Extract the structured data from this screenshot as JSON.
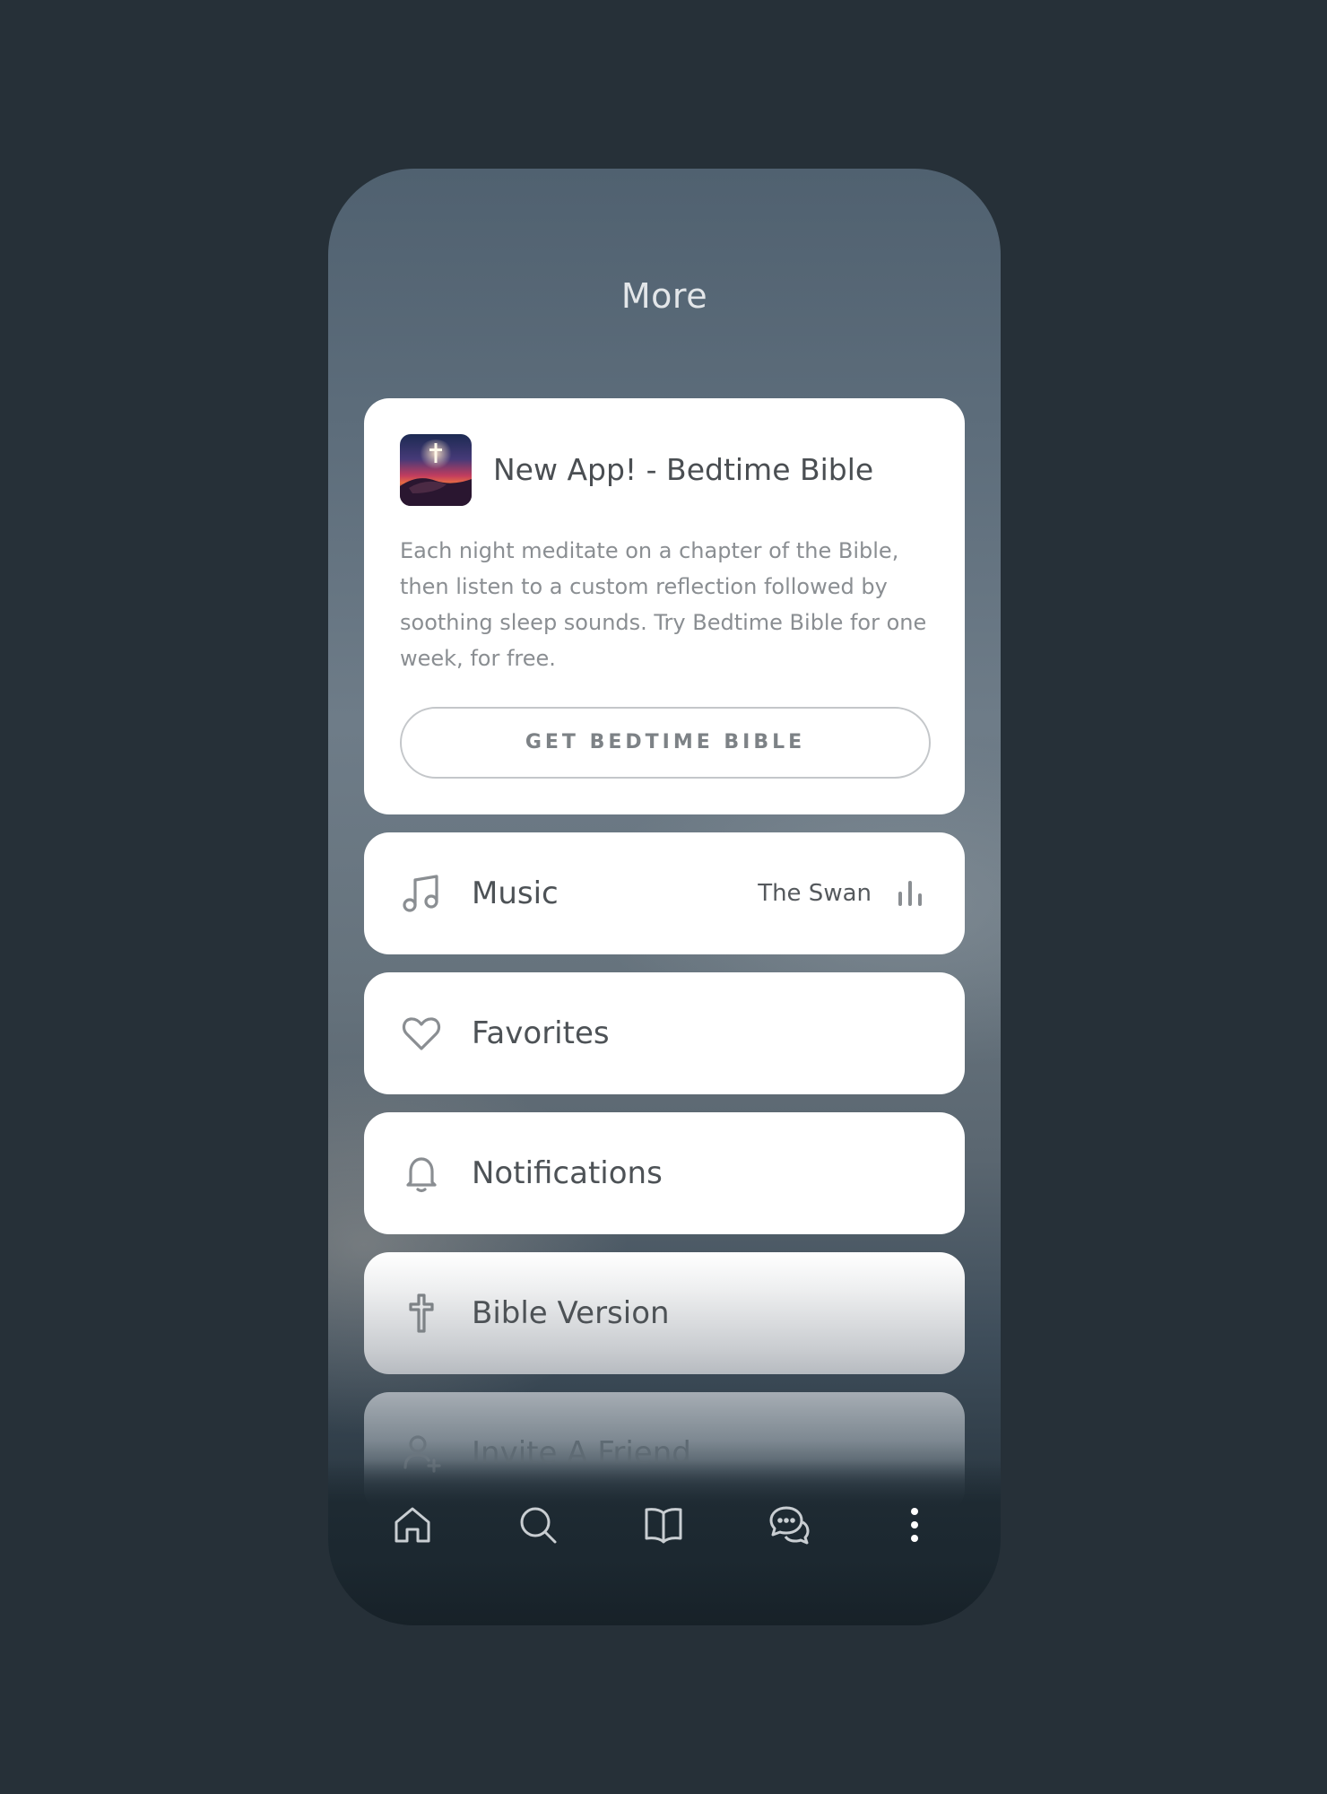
{
  "page": {
    "title": "More"
  },
  "promo": {
    "title": "New App! - Bedtime Bible",
    "description": "Each night meditate on a chapter of the Bible, then listen to a custom reflection followed by soothing sleep sounds. Try Bedtime Bible for one week, for free.",
    "button_label": "GET BEDTIME BIBLE",
    "icon": "bedtime-bible-app-icon"
  },
  "menu": {
    "music": {
      "label": "Music",
      "value": "The Swan",
      "icon": "music-note-icon",
      "trailing_icon": "audio-bars-icon"
    },
    "favorites": {
      "label": "Favorites",
      "icon": "heart-icon"
    },
    "notifications": {
      "label": "Notifications",
      "icon": "bell-icon"
    },
    "bible_version": {
      "label": "Bible Version",
      "icon": "cross-icon"
    },
    "invite": {
      "label": "Invite A Friend",
      "icon": "add-person-icon"
    }
  },
  "tabbar": {
    "items": [
      {
        "name": "home",
        "icon": "home-icon"
      },
      {
        "name": "search",
        "icon": "search-icon"
      },
      {
        "name": "bible",
        "icon": "book-icon"
      },
      {
        "name": "chat",
        "icon": "chat-bubbles-icon"
      },
      {
        "name": "more",
        "icon": "more-vertical-icon",
        "active": true
      }
    ]
  },
  "colors": {
    "background": "#263038",
    "card": "#ffffff",
    "icon_gray": "#8a8e92",
    "tab_icon": "#c9ced2",
    "tab_active": "#ffffff"
  }
}
